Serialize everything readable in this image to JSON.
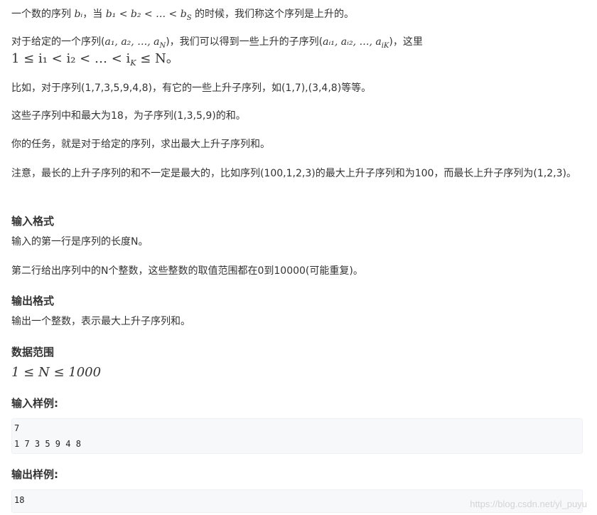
{
  "paragraphs": {
    "p1": {
      "text_a": "一个数的序列 ",
      "math_a": "bᵢ",
      "text_b": "，当 ",
      "math_b": "b₁ < b₂ < … < b",
      "math_b_sub": "S",
      "text_c": " 的时候，我们称这个序列是上升的。"
    },
    "p2": {
      "text_a": "对于给定的一个序列(",
      "math_a": "a₁, a₂, …, a",
      "math_a_sub": "N",
      "text_b": ")，我们可以得到一些上升的子序列(",
      "math_b": "aᵢ₁, aᵢ₂, …, a",
      "math_b_sub": "iK",
      "text_c": ")，这里",
      "line2_math": "1 ≤ i₁ < i₂ < … < i",
      "line2_sub": "K",
      "line2_tail": " ≤ N。"
    },
    "p3": "比如，对于序列(1,7,3,5,9,4,8)，有它的一些上升子序列，如(1,7),(3,4,8)等等。",
    "p4": "这些子序列中和最大为18，为子序列(1,3,5,9)的和。",
    "p5": "你的任务，就是对于给定的序列，求出最大上升子序列和。",
    "p6": "注意，最长的上升子序列的和不一定是最大的，比如序列(100,1,2,3)的最大上升子序列和为100，而最长上升子序列为(1,2,3)。"
  },
  "input_format": {
    "heading": "输入格式",
    "line1": "输入的第一行是序列的长度N。",
    "line2": "第二行给出序列中的N个整数，这些整数的取值范围都在0到10000(可能重复)。"
  },
  "output_format": {
    "heading": "输出格式",
    "line1": "输出一个整数，表示最大上升子序列和。"
  },
  "data_range": {
    "heading": "数据范围",
    "math": "1 ≤ N ≤ 1000"
  },
  "sample_input": {
    "heading": "输入样例:",
    "lines": [
      "7",
      "1 7 3 5 9 4 8"
    ]
  },
  "sample_output": {
    "heading": "输出样例:",
    "lines": [
      "18"
    ]
  },
  "watermark": "https://blog.csdn.net/yl_puyu"
}
